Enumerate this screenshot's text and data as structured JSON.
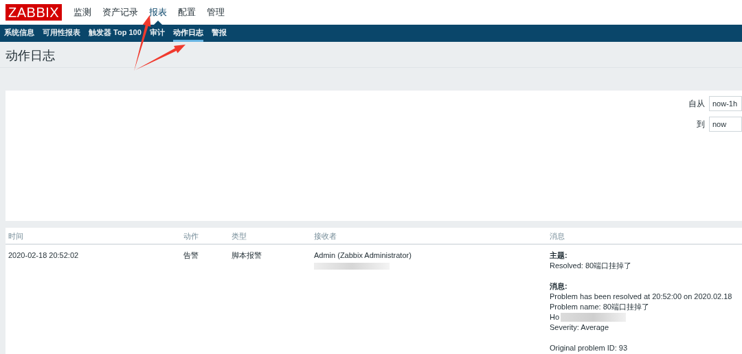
{
  "logo": "ZABBIX",
  "main_menu": [
    {
      "label": "监测",
      "selected": false
    },
    {
      "label": "资产记录",
      "selected": false
    },
    {
      "label": "报表",
      "selected": true
    },
    {
      "label": "配置",
      "selected": false
    },
    {
      "label": "管理",
      "selected": false
    }
  ],
  "sub_menu": [
    {
      "label": "系统信息",
      "selected": false
    },
    {
      "label": "可用性报表",
      "selected": false
    },
    {
      "label": "触发器 Top 100",
      "selected": false
    },
    {
      "label": "审计",
      "selected": false
    },
    {
      "label": "动作日志",
      "selected": true
    },
    {
      "label": "警报",
      "selected": false
    }
  ],
  "page_title": "动作日志",
  "filter": {
    "from_label": "自从",
    "from_value": "now-1h",
    "to_label": "到",
    "to_value": "now"
  },
  "table": {
    "columns": [
      "时间",
      "动作",
      "类型",
      "接收者",
      "消息"
    ],
    "rows": [
      {
        "time": "2020-02-18 20:52:02",
        "action": "告警",
        "type": "脚本报警",
        "recipient": "Admin (Zabbix Administrator)",
        "message": [
          {
            "kind": "heading",
            "text": "主题:"
          },
          {
            "kind": "line",
            "text": "Resolved: 80端口挂掉了"
          },
          {
            "kind": "gap"
          },
          {
            "kind": "heading",
            "text": "消息:"
          },
          {
            "kind": "line",
            "text": "Problem has been resolved at 20:52:00 on 2020.02.18"
          },
          {
            "kind": "line",
            "text": "Problem name: 80端口挂掉了"
          },
          {
            "kind": "redacted",
            "text": "Ho"
          },
          {
            "kind": "line",
            "text": "Severity: Average"
          },
          {
            "kind": "gap"
          },
          {
            "kind": "line",
            "text": "Original problem ID: 93"
          }
        ]
      }
    ]
  }
}
